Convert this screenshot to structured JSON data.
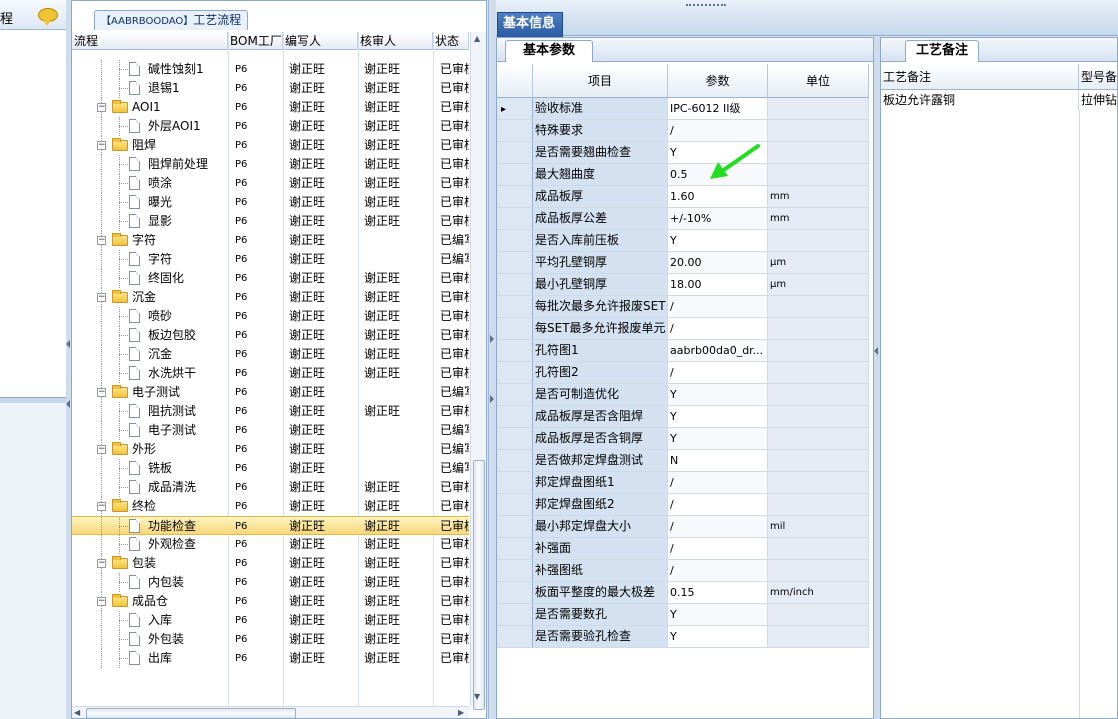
{
  "left_panel": {
    "header_text": "程"
  },
  "tree_panel": {
    "title_prefix": "【AABRBOODAO】",
    "title": "工艺流程",
    "headers": [
      "流程",
      "BOM工厂",
      "编写人",
      "核审人",
      "状态"
    ],
    "rows": [
      {
        "name": "碱性蚀刻1",
        "level": 2,
        "bom": "P6",
        "writer": "谢正旺",
        "reviewer": "谢正旺",
        "status": "已审核"
      },
      {
        "name": "退锡1",
        "level": 2,
        "bom": "P6",
        "writer": "谢正旺",
        "reviewer": "谢正旺",
        "status": "已审核"
      },
      {
        "name": "AOI1",
        "level": 1,
        "bom": "P6",
        "writer": "谢正旺",
        "reviewer": "谢正旺",
        "status": "已审核"
      },
      {
        "name": "外层AOI1",
        "level": 2,
        "bom": "P6",
        "writer": "谢正旺",
        "reviewer": "谢正旺",
        "status": "已审核"
      },
      {
        "name": "阻焊",
        "level": 1,
        "bom": "P6",
        "writer": "谢正旺",
        "reviewer": "谢正旺",
        "status": "已审核"
      },
      {
        "name": "阻焊前处理",
        "level": 2,
        "bom": "P6",
        "writer": "谢正旺",
        "reviewer": "谢正旺",
        "status": "已审核"
      },
      {
        "name": "喷涂",
        "level": 2,
        "bom": "P6",
        "writer": "谢正旺",
        "reviewer": "谢正旺",
        "status": "已审核"
      },
      {
        "name": "曝光",
        "level": 2,
        "bom": "P6",
        "writer": "谢正旺",
        "reviewer": "谢正旺",
        "status": "已审核"
      },
      {
        "name": "显影",
        "level": 2,
        "bom": "P6",
        "writer": "谢正旺",
        "reviewer": "谢正旺",
        "status": "已审核"
      },
      {
        "name": "字符",
        "level": 1,
        "bom": "P6",
        "writer": "谢正旺",
        "reviewer": "",
        "status": "已编写"
      },
      {
        "name": "字符",
        "level": 2,
        "bom": "P6",
        "writer": "谢正旺",
        "reviewer": "",
        "status": "已编写"
      },
      {
        "name": "终固化",
        "level": 2,
        "bom": "P6",
        "writer": "谢正旺",
        "reviewer": "谢正旺",
        "status": "已审核"
      },
      {
        "name": "沉金",
        "level": 1,
        "bom": "P6",
        "writer": "谢正旺",
        "reviewer": "谢正旺",
        "status": "已审核"
      },
      {
        "name": "喷砂",
        "level": 2,
        "bom": "P6",
        "writer": "谢正旺",
        "reviewer": "谢正旺",
        "status": "已审核"
      },
      {
        "name": "板边包胶",
        "level": 2,
        "bom": "P6",
        "writer": "谢正旺",
        "reviewer": "谢正旺",
        "status": "已审核"
      },
      {
        "name": "沉金",
        "level": 2,
        "bom": "P6",
        "writer": "谢正旺",
        "reviewer": "谢正旺",
        "status": "已审核"
      },
      {
        "name": "水洗烘干",
        "level": 2,
        "bom": "P6",
        "writer": "谢正旺",
        "reviewer": "谢正旺",
        "status": "已审核"
      },
      {
        "name": "电子测试",
        "level": 1,
        "bom": "P6",
        "writer": "谢正旺",
        "reviewer": "",
        "status": "已编写"
      },
      {
        "name": "阻抗测试",
        "level": 2,
        "bom": "P6",
        "writer": "谢正旺",
        "reviewer": "谢正旺",
        "status": "已审核"
      },
      {
        "name": "电子测试",
        "level": 2,
        "bom": "P6",
        "writer": "谢正旺",
        "reviewer": "",
        "status": "已编写"
      },
      {
        "name": "外形",
        "level": 1,
        "bom": "P6",
        "writer": "谢正旺",
        "reviewer": "",
        "status": "已编写"
      },
      {
        "name": "铣板",
        "level": 2,
        "bom": "P6",
        "writer": "谢正旺",
        "reviewer": "",
        "status": "已编写"
      },
      {
        "name": "成品清洗",
        "level": 2,
        "bom": "P6",
        "writer": "谢正旺",
        "reviewer": "谢正旺",
        "status": "已审核"
      },
      {
        "name": "终检",
        "level": 1,
        "bom": "P6",
        "writer": "谢正旺",
        "reviewer": "谢正旺",
        "status": "已审核"
      },
      {
        "name": "功能检查",
        "level": 2,
        "bom": "P6",
        "writer": "谢正旺",
        "reviewer": "谢正旺",
        "status": "已审核",
        "selected": true
      },
      {
        "name": "外观检查",
        "level": 2,
        "bom": "P6",
        "writer": "谢正旺",
        "reviewer": "谢正旺",
        "status": "已审核"
      },
      {
        "name": "包装",
        "level": 1,
        "bom": "P6",
        "writer": "谢正旺",
        "reviewer": "谢正旺",
        "status": "已审核"
      },
      {
        "name": "内包装",
        "level": 2,
        "bom": "P6",
        "writer": "谢正旺",
        "reviewer": "谢正旺",
        "status": "已审核"
      },
      {
        "name": "成品仓",
        "level": 1,
        "bom": "P6",
        "writer": "谢正旺",
        "reviewer": "谢正旺",
        "status": "已审核"
      },
      {
        "name": "入库",
        "level": 2,
        "bom": "P6",
        "writer": "谢正旺",
        "reviewer": "谢正旺",
        "status": "已审核"
      },
      {
        "name": "外包装",
        "level": 2,
        "bom": "P6",
        "writer": "谢正旺",
        "reviewer": "谢正旺",
        "status": "已审核"
      },
      {
        "name": "出库",
        "level": 2,
        "bom": "P6",
        "writer": "谢正旺",
        "reviewer": "谢正旺",
        "status": "已审核"
      }
    ]
  },
  "main_tab": "基本信息",
  "params_panel": {
    "tab": "基本参数",
    "headers": [
      "项目",
      "参数",
      "单位"
    ],
    "rows": [
      {
        "item": "验收标准",
        "value": "IPC-6012 II级",
        "unit": "",
        "current": true
      },
      {
        "item": "特殊要求",
        "value": "/",
        "unit": ""
      },
      {
        "item": "是否需要翘曲检查",
        "value": "Y",
        "unit": ""
      },
      {
        "item": "最大翘曲度",
        "value": "0.5",
        "unit": ""
      },
      {
        "item": "成品板厚",
        "value": "1.60",
        "unit": "mm"
      },
      {
        "item": "成品板厚公差",
        "value": "+/-10%",
        "unit": "mm"
      },
      {
        "item": "是否入库前压板",
        "value": "Y",
        "unit": ""
      },
      {
        "item": "平均孔壁铜厚",
        "value": "20.00",
        "unit": "μm"
      },
      {
        "item": "最小孔壁铜厚",
        "value": "18.00",
        "unit": "μm"
      },
      {
        "item": "每批次最多允许报废SET",
        "value": "/",
        "unit": ""
      },
      {
        "item": "每SET最多允许报废单元",
        "value": "/",
        "unit": ""
      },
      {
        "item": "孔符图1",
        "value": "aabrb00da0_dr...",
        "unit": ""
      },
      {
        "item": "孔符图2",
        "value": "/",
        "unit": ""
      },
      {
        "item": "是否可制造优化",
        "value": "Y",
        "unit": ""
      },
      {
        "item": "成品板厚是否含阻焊",
        "value": "Y",
        "unit": ""
      },
      {
        "item": "成品板厚是否含铜厚",
        "value": "Y",
        "unit": ""
      },
      {
        "item": "是否做邦定焊盘测试",
        "value": "N",
        "unit": ""
      },
      {
        "item": "邦定焊盘图纸1",
        "value": "/",
        "unit": ""
      },
      {
        "item": "邦定焊盘图纸2",
        "value": "/",
        "unit": ""
      },
      {
        "item": "最小邦定焊盘大小",
        "value": "/",
        "unit": "mil"
      },
      {
        "item": "补强面",
        "value": "/",
        "unit": ""
      },
      {
        "item": "补强图纸",
        "value": "/",
        "unit": ""
      },
      {
        "item": "板面平整度的最大极差",
        "value": "0.15",
        "unit": "mm/inch"
      },
      {
        "item": "是否需要数孔",
        "value": "Y",
        "unit": ""
      },
      {
        "item": "是否需要验孔检查",
        "value": "Y",
        "unit": ""
      }
    ]
  },
  "notes_panel": {
    "tab": "工艺备注",
    "headers": [
      "工艺备注",
      "型号备注"
    ],
    "row": [
      "板边允许露铜",
      "拉伸钻"
    ]
  },
  "colors": {
    "accent": "#2a5aa3",
    "selection": "#f7d77a",
    "arrow": "#22dd22"
  }
}
